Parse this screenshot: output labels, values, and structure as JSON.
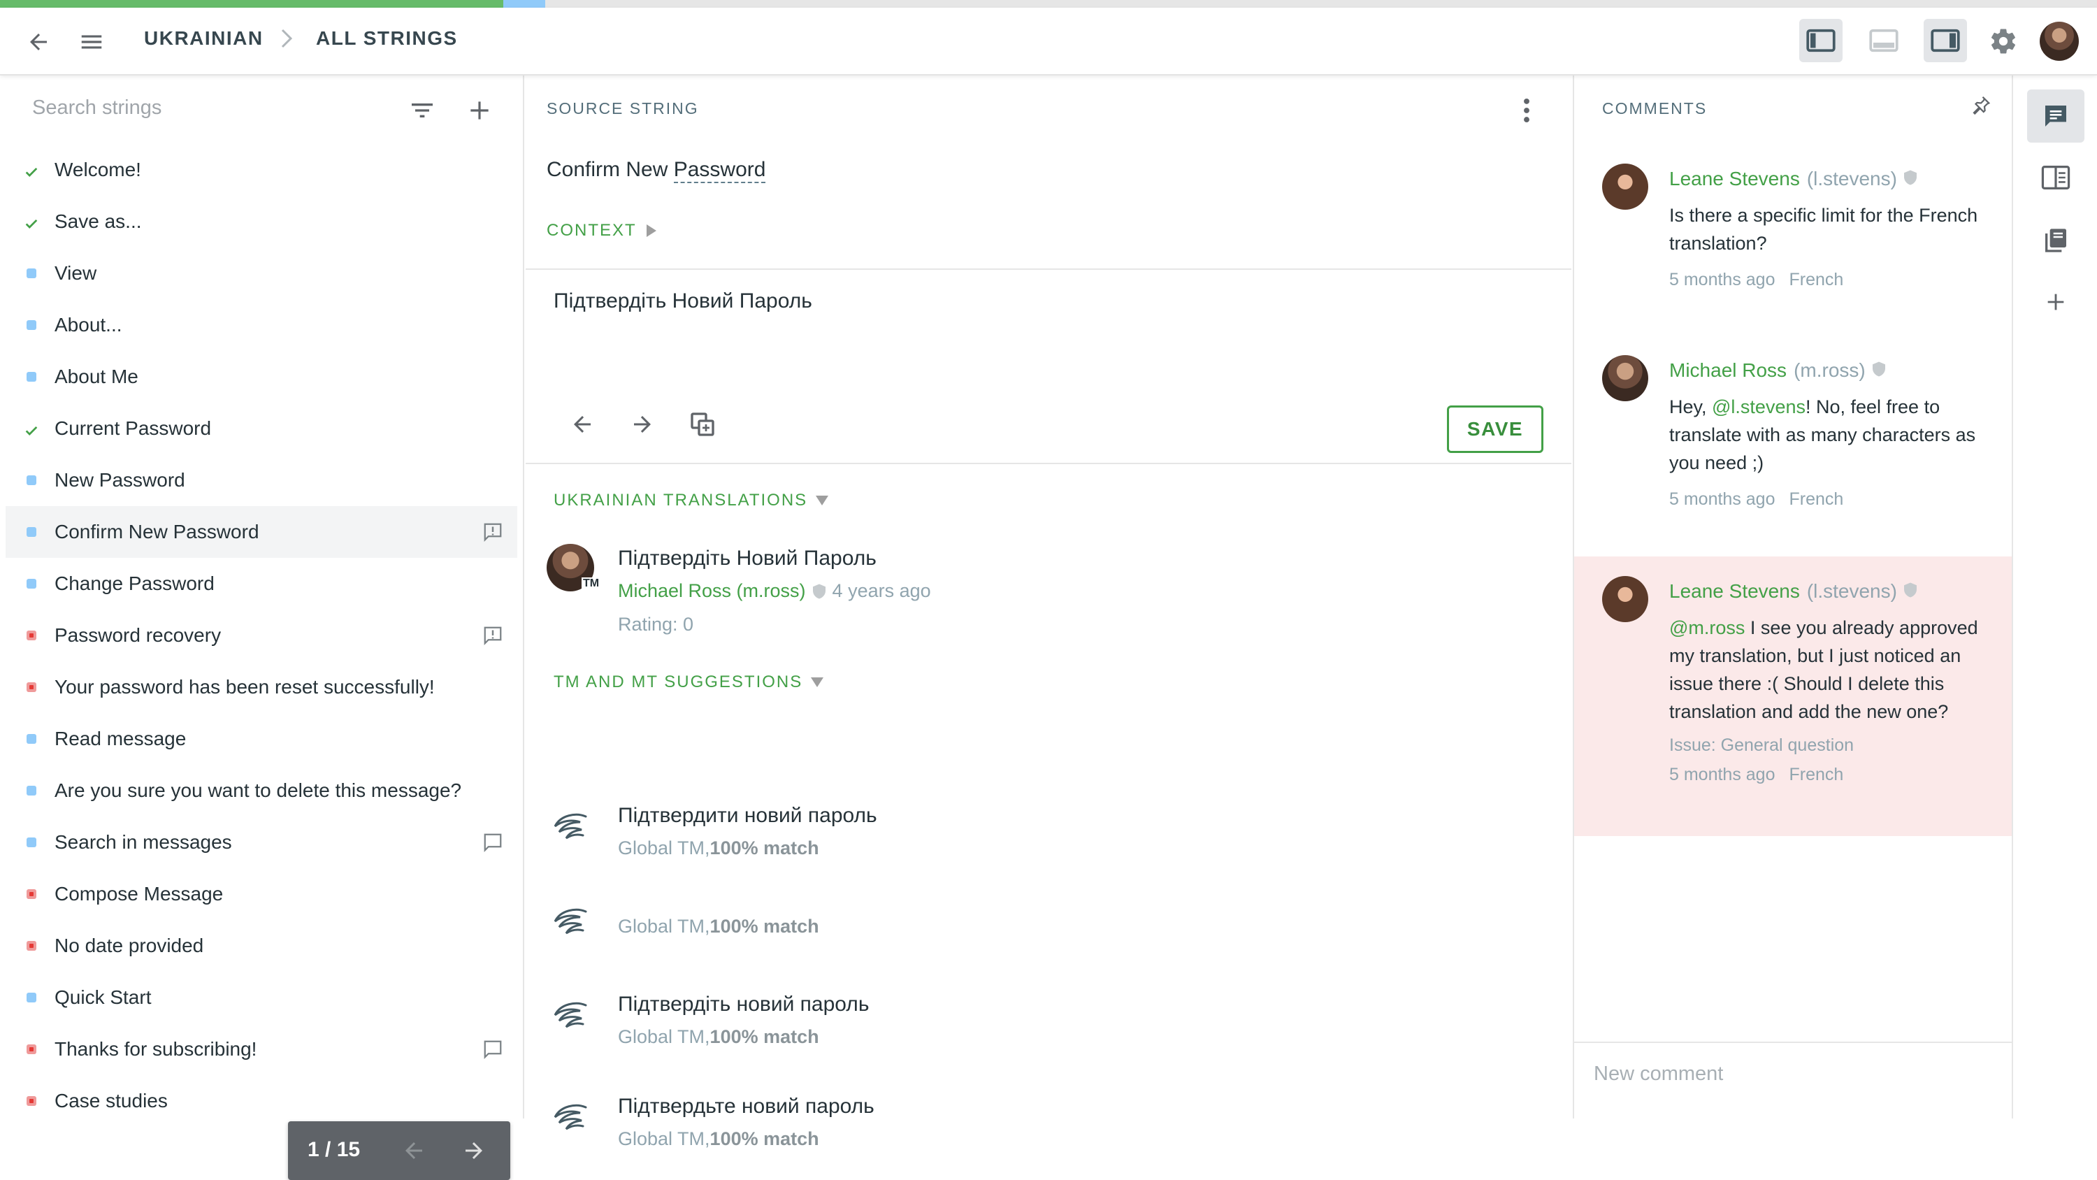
{
  "progress": {
    "translated_fraction": 0.24,
    "approved_fraction": 0.02
  },
  "header": {
    "language": "UKRAINIAN",
    "view": "ALL STRINGS",
    "icons": [
      "back-arrow-icon",
      "menu-icon",
      "layout-left-panel-icon",
      "layout-bottom-panel-icon",
      "layout-right-panel-icon",
      "gear-icon"
    ]
  },
  "strings_panel": {
    "search_placeholder": "Search strings",
    "items": [
      {
        "label": "Welcome!",
        "status": "approved",
        "icon": ""
      },
      {
        "label": "Save as...",
        "status": "approved",
        "icon": ""
      },
      {
        "label": "View",
        "status": "translated",
        "icon": ""
      },
      {
        "label": "About...",
        "status": "translated",
        "icon": ""
      },
      {
        "label": "About Me",
        "status": "translated",
        "icon": ""
      },
      {
        "label": "Current Password",
        "status": "approved",
        "icon": ""
      },
      {
        "label": "New Password",
        "status": "translated",
        "icon": ""
      },
      {
        "label": "Confirm New Password",
        "status": "translated",
        "icon": "issue-icon",
        "selected": true
      },
      {
        "label": "Change Password",
        "status": "translated",
        "icon": ""
      },
      {
        "label": "Password recovery",
        "status": "untranslated",
        "icon": "issue-icon"
      },
      {
        "label": "Your password has been reset successfully!",
        "status": "untranslated",
        "icon": ""
      },
      {
        "label": "Read message",
        "status": "translated",
        "icon": ""
      },
      {
        "label": "Are you sure you want to delete this message?",
        "status": "translated",
        "icon": ""
      },
      {
        "label": "Search in messages",
        "status": "translated",
        "icon": "comment-icon"
      },
      {
        "label": "Compose Message",
        "status": "untranslated",
        "icon": ""
      },
      {
        "label": "No date provided",
        "status": "untranslated",
        "icon": ""
      },
      {
        "label": "Quick Start",
        "status": "translated",
        "icon": ""
      },
      {
        "label": "Thanks for subscribing!",
        "status": "untranslated",
        "icon": "comment-icon"
      },
      {
        "label": "Case studies",
        "status": "untranslated",
        "icon": ""
      }
    ],
    "pager": "1 / 15",
    "colors": {
      "approved": "#43a047",
      "translated": "#90caf9",
      "untranslated": "#e53935"
    }
  },
  "editor": {
    "source_label": "SOURCE STRING",
    "source_text_before": "Confirm New ",
    "source_text_term": "Password",
    "context_label": "CONTEXT",
    "translation_value": "Підтвердіть Новий Пароль",
    "save_label": "SAVE",
    "translations_title": "UKRAINIAN TRANSLATIONS",
    "translation": {
      "text": "Підтвердіть Новий Пароль",
      "author": "Michael Ross (m.ross)",
      "time": "4 years ago",
      "rating": "Rating: 0",
      "avatar_tag": "TM"
    },
    "suggestions_title": "TM AND MT SUGGESTIONS",
    "suggestions": [
      {
        "text": "Підтвердити новий пароль",
        "source": "Global TM, ",
        "match": "100% match"
      },
      {
        "text": "",
        "source": "Global TM, ",
        "match": "100% match"
      },
      {
        "text": "Підтвердіть новий пароль",
        "source": "Global TM, ",
        "match": "100% match"
      },
      {
        "text": "Підтвердьте новий пароль",
        "source": "Global TM, ",
        "match": "100% match"
      }
    ]
  },
  "comments": {
    "title": "COMMENTS",
    "items": [
      {
        "name": "Leane Stevens",
        "login": "(l.stevens)",
        "mention": "",
        "text": "Is there a specific limit for the French translation?",
        "time": "5 months ago",
        "lang": "French",
        "issue": ""
      },
      {
        "name": "Michael Ross",
        "login": "(m.ross)",
        "mention_prefix": "Hey, ",
        "mention": "@l.stevens",
        "text": "! No, feel free to translate with as many characters as you need ;)",
        "time": "5 months ago",
        "lang": "French",
        "issue": ""
      },
      {
        "name": "Leane Stevens",
        "login": "(l.stevens)",
        "mention": "@m.ross",
        "text": " I see you already approved my translation, but I just noticed an issue there :( Should I delete this translation and add the new one?",
        "time": "5 months ago",
        "lang": "French",
        "issue": "Issue: General question"
      }
    ],
    "new_comment_placeholder": "New comment"
  },
  "rail": {
    "icons": [
      "comments-icon",
      "glossary-icon",
      "terms-icon",
      "add-icon"
    ]
  }
}
